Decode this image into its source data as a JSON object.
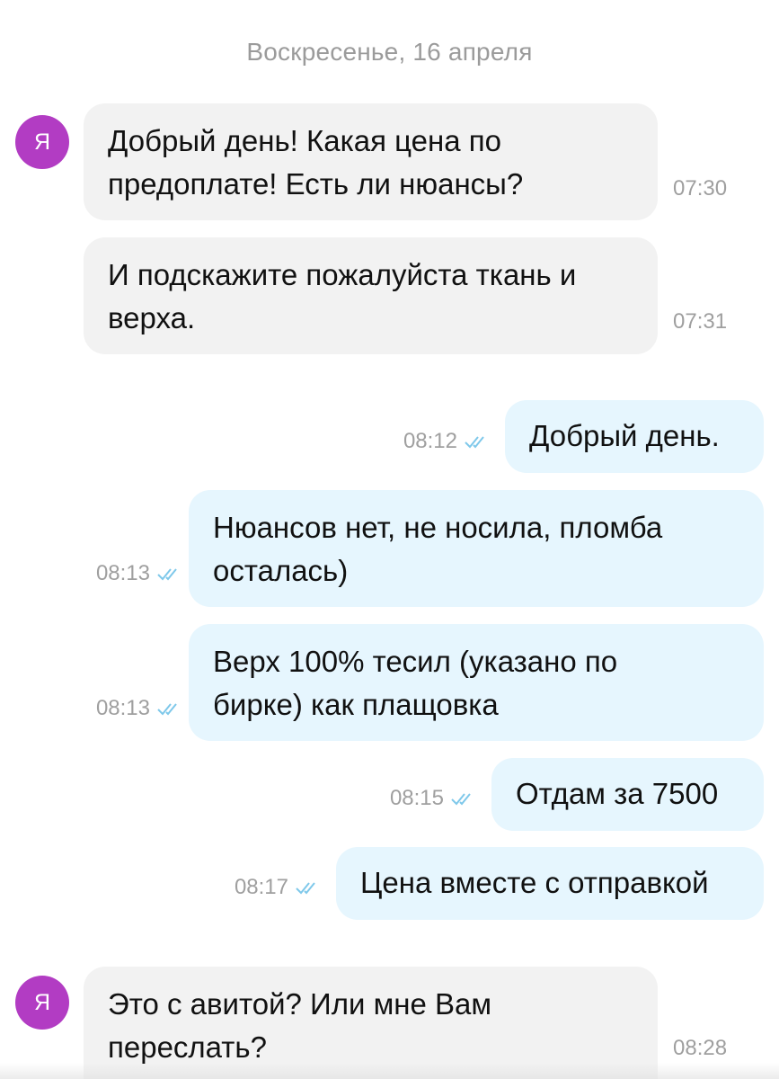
{
  "chat": {
    "date_separator": "Воскресенье, 16 апреля",
    "avatar_letter": "Я",
    "colors": {
      "avatar": "#b23cc3",
      "incoming_bubble": "#f2f2f2",
      "outgoing_bubble": "#e6f6fe",
      "read_check": "#7ec8ea"
    },
    "messages": [
      {
        "direction": "in",
        "text_lines": [
          "Добрый день! Какая цена по",
          "предоплате! Есть ли нюансы?"
        ],
        "time": "07:30"
      },
      {
        "direction": "in",
        "text_lines": [
          "И подскажите пожалуйста ткань и",
          "верха."
        ],
        "time": "07:31"
      },
      {
        "direction": "out",
        "text_lines": [
          "Добрый день."
        ],
        "time": "08:12",
        "status_icon": "double-check-read-icon"
      },
      {
        "direction": "out",
        "text_lines": [
          "Нюансов нет,  не носила,  пломба",
          "осталась)"
        ],
        "time": "08:13",
        "status_icon": "double-check-read-icon"
      },
      {
        "direction": "out",
        "text_lines": [
          "Верх 100% тесил (указано по",
          "бирке) как плащовка"
        ],
        "time": "08:13",
        "status_icon": "double-check-read-icon"
      },
      {
        "direction": "out",
        "text_lines": [
          "Отдам за 7500"
        ],
        "time": "08:15",
        "status_icon": "double-check-read-icon"
      },
      {
        "direction": "out",
        "text_lines": [
          "Цена вместе с отправкой"
        ],
        "time": "08:17",
        "status_icon": "double-check-read-icon"
      },
      {
        "direction": "in",
        "text_lines": [
          "Это с авитой? Или мне Вам",
          "переслать?"
        ],
        "time": "08:28"
      }
    ]
  }
}
